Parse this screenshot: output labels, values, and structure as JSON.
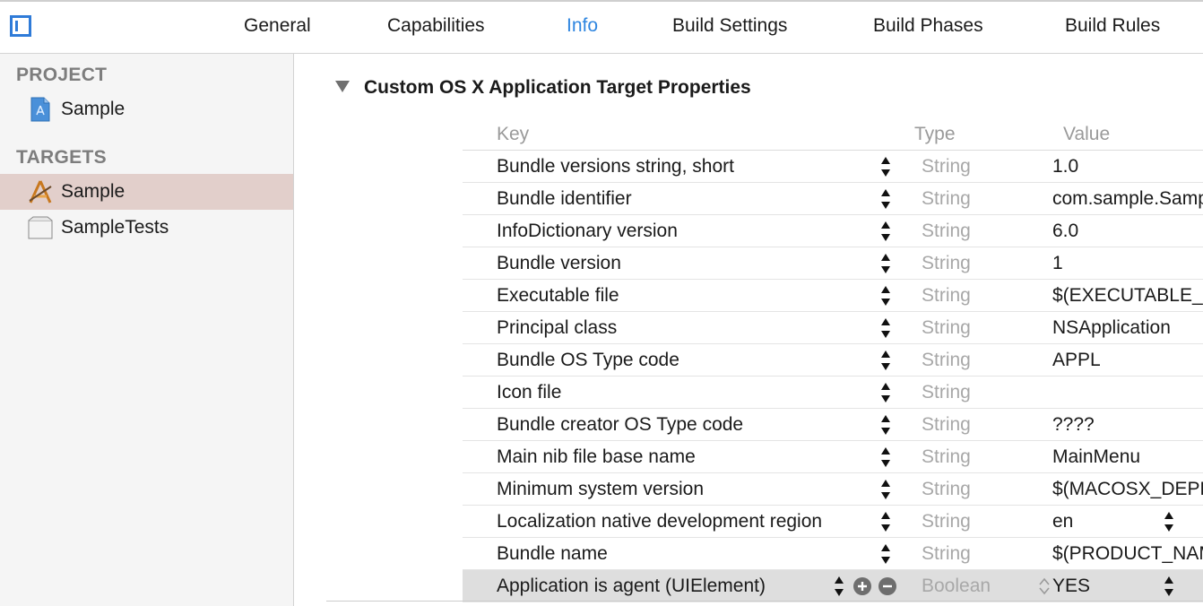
{
  "tabs": [
    {
      "label": "General"
    },
    {
      "label": "Capabilities"
    },
    {
      "label": "Info",
      "active": true
    },
    {
      "label": "Build Settings"
    },
    {
      "label": "Build Phases"
    },
    {
      "label": "Build Rules"
    }
  ],
  "sidebar": {
    "project_header": "PROJECT",
    "project_items": [
      {
        "label": "Sample",
        "icon": "project-file-icon"
      }
    ],
    "targets_header": "TARGETS",
    "target_items": [
      {
        "label": "Sample",
        "icon": "application-target-icon",
        "selected": true
      },
      {
        "label": "SampleTests",
        "icon": "test-bundle-icon"
      }
    ]
  },
  "section": {
    "title": "Custom OS X Application Target Properties",
    "expanded": true
  },
  "table": {
    "headers": {
      "key": "Key",
      "type": "Type",
      "value": "Value"
    },
    "rows": [
      {
        "key": "Bundle versions string, short",
        "type": "String",
        "value": "1.0"
      },
      {
        "key": "Bundle identifier",
        "type": "String",
        "value": "com.sample.Sample"
      },
      {
        "key": "InfoDictionary version",
        "type": "String",
        "value": "6.0"
      },
      {
        "key": "Bundle version",
        "type": "String",
        "value": "1"
      },
      {
        "key": "Executable file",
        "type": "String",
        "value": "$(EXECUTABLE_NAME)"
      },
      {
        "key": "Principal class",
        "type": "String",
        "value": "NSApplication"
      },
      {
        "key": "Bundle OS Type code",
        "type": "String",
        "value": "APPL"
      },
      {
        "key": "Icon file",
        "type": "String",
        "value": ""
      },
      {
        "key": "Bundle creator OS Type code",
        "type": "String",
        "value": "????"
      },
      {
        "key": "Main nib file base name",
        "type": "String",
        "value": "MainMenu"
      },
      {
        "key": "Minimum system version",
        "type": "String",
        "value": "$(MACOSX_DEPLOYMENT_TARGET)"
      },
      {
        "key": "Localization native development region",
        "type": "String",
        "value": "en",
        "value_popup": true
      },
      {
        "key": "Bundle name",
        "type": "String",
        "value": "$(PRODUCT_NAME)"
      },
      {
        "key": "Application is agent (UIElement)",
        "type": "Boolean",
        "value": "YES",
        "selected": true,
        "value_popup": true,
        "type_popup": true
      }
    ]
  },
  "colors": {
    "accent": "#2f86e0",
    "selection": "#e2cfcb",
    "row_selected": "#dedede"
  }
}
